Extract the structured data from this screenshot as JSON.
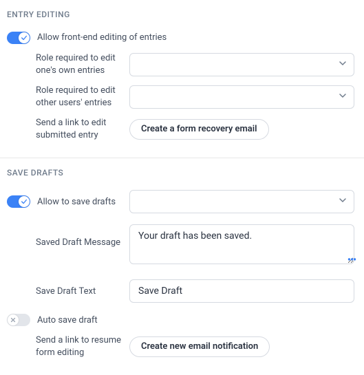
{
  "entry_editing": {
    "header": "ENTRY EDITING",
    "allow_label": "Allow front-end editing of entries",
    "role_own_label": "Role required to edit one's own entries",
    "role_own_value": "",
    "role_other_label": "Role required to edit other users' entries",
    "role_other_value": "",
    "send_link_label": "Send a link to edit submitted entry",
    "recovery_button": "Create a form recovery email"
  },
  "save_drafts": {
    "header": "SAVE DRAFTS",
    "allow_label": "Allow to save drafts",
    "allow_select_value": "",
    "saved_msg_label": "Saved Draft Message",
    "saved_msg_value": "Your draft has been saved.",
    "save_text_label": "Save Draft Text",
    "save_text_value": "Save Draft",
    "auto_save_label": "Auto save draft",
    "resume_link_label": "Send a link to resume form editing",
    "notif_button": "Create new email notification"
  }
}
